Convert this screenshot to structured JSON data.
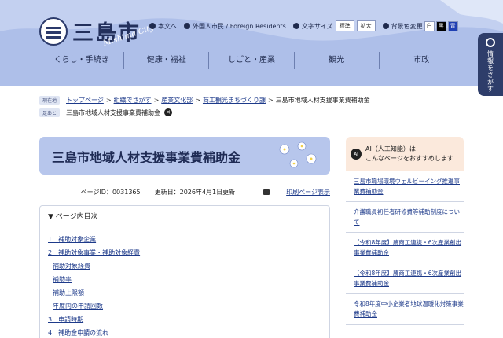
{
  "colors": {
    "header_bg": "#aebfe9",
    "navy": "#23305c",
    "link": "#1d3a8a",
    "title_banner": "#b7c6ec",
    "reco_bg": "#fbe9dc"
  },
  "header": {
    "logo_text": "三島市",
    "logo_sub": "Mishima City",
    "util": {
      "text_only": "本文へ",
      "foreign": "外国人市民 / Foreign Residents",
      "font_size_label": "文字サイズ",
      "font_standard": "標準",
      "font_large": "拡大",
      "bg_color_label": "背景色変更",
      "color_white": "白",
      "color_black": "黒",
      "color_blue": "青"
    },
    "nav": [
      "くらし・手続き",
      "健康・福祉",
      "しごと・産業",
      "観光",
      "市政"
    ],
    "side_tab": "情報をさがす"
  },
  "breadcrumb": {
    "current_tag": "現在地",
    "items": [
      "トップページ",
      "組織でさがす",
      "産業文化部",
      "商工観光まちづくり課"
    ],
    "current": "三島市地域人材支援事業費補助金",
    "history_tag": "足あと",
    "history_item": "三島市地域人材支援事業費補助金"
  },
  "page": {
    "title": "三島市地域人材支援事業費補助金",
    "page_id": "ページID：0031365",
    "updated": "更新日：2026年4月1日更新",
    "print": "印刷ページ表示"
  },
  "toc": {
    "heading": "▼ ページ内目次",
    "items": [
      {
        "label": "1　補助対象企業",
        "sub": false
      },
      {
        "label": "2　補助対象事業・補助対象経費",
        "sub": false
      },
      {
        "label": "補助対象経費",
        "sub": true
      },
      {
        "label": "補助率",
        "sub": true
      },
      {
        "label": "補助上限額",
        "sub": true
      },
      {
        "label": "年度内の申請回数",
        "sub": true
      },
      {
        "label": "3　申請時期",
        "sub": false
      },
      {
        "label": "4　補助金申請の流れ",
        "sub": false
      }
    ]
  },
  "recommend": {
    "ai_icon": "AI",
    "line1": "AI（人工知能）は",
    "line2": "こんなページをおすすめします",
    "items": [
      "三島市職場環境ウェルビーイング推進事業費補助金",
      "介護職員初任者研修費等補助制度について",
      "【令和8年度】農商工連携・6次産業創出事業費補助金",
      "【令和8年度】農商工連携・6次産業創出事業費補助金",
      "令和8年度中小企業者地球温暖化対策事業費補助金"
    ]
  }
}
